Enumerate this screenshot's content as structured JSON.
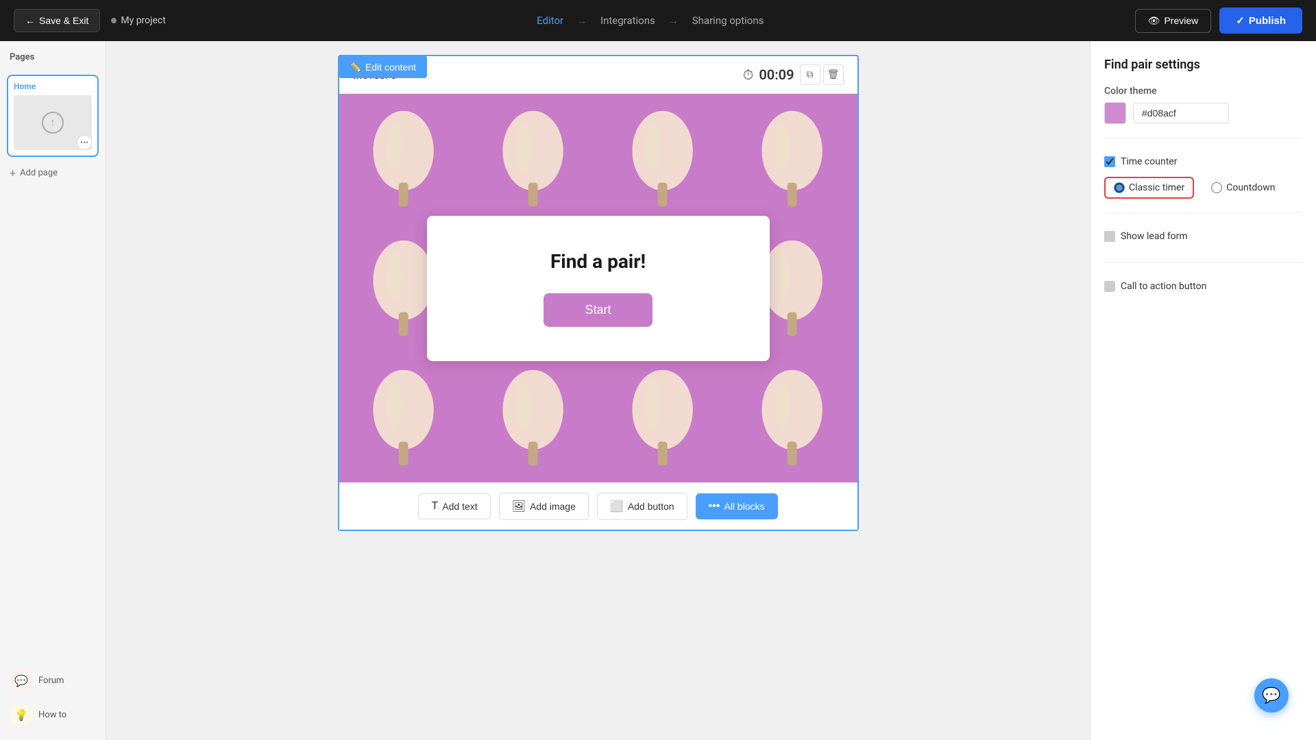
{
  "nav": {
    "save_exit_label": "Save & Exit",
    "project_name": "My project",
    "editor_label": "Editor",
    "integrations_label": "Integrations",
    "sharing_options_label": "Sharing options",
    "preview_label": "Preview",
    "publish_label": "Publish"
  },
  "sidebar": {
    "pages_title": "Pages",
    "home_page_label": "Home",
    "add_page_label": "Add page",
    "forum_label": "Forum",
    "howto_label": "How to"
  },
  "canvas": {
    "edit_content_label": "Edit content",
    "moves_label": "Moves:",
    "moves_value": "0",
    "timer_value": "00:09",
    "game_title": "Find a pair!",
    "start_btn_label": "Start",
    "add_text_label": "Add text",
    "add_image_label": "Add image",
    "add_button_label": "Add button",
    "all_blocks_label": "All blocks"
  },
  "right_panel": {
    "title": "Find pair settings",
    "color_theme_label": "Color theme",
    "color_value": "#d08acf",
    "time_counter_label": "Time counter",
    "classic_timer_label": "Classic timer",
    "countdown_label": "Countdown",
    "show_lead_form_label": "Show lead form",
    "call_to_action_label": "Call to action button"
  }
}
